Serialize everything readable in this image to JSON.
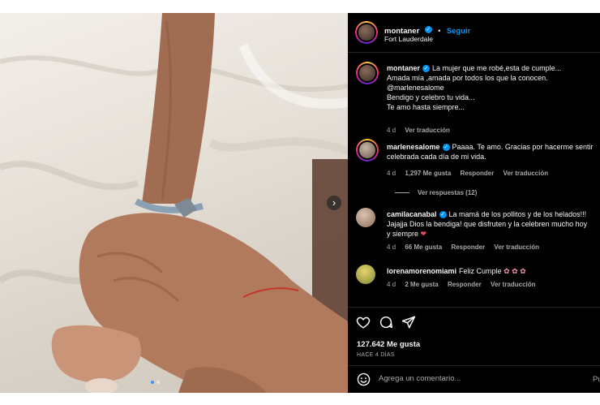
{
  "post": {
    "username": "montaner",
    "follow_label": "Seguir",
    "location": "Fort Lauderdale"
  },
  "caption": {
    "username": "montaner",
    "line1": "La mujer que me robé,esta de cumple...",
    "line2": "Amada mía ,amada por todos los que la conocen.",
    "line3": "@marlenesalome",
    "line4": "Bendigo y celebro tu vida...",
    "line5": "Te amo hasta siempre...",
    "time": "4 d",
    "translate": "Ver traducción"
  },
  "comments": [
    {
      "username": "marlenesalome",
      "line1": "Paaaa. Te amo. Gracias por hacerme sentir",
      "line2": "celebrada cada día de mi vida.",
      "time": "4 d",
      "likes": "1,297 Me gusta",
      "reply": "Responder",
      "translate": "Ver traducción",
      "replies": "Ver respuestas (12)"
    },
    {
      "username": "camilacanabal",
      "line1": "La mamá de los pollitos y de los helados!!!",
      "line2": "Jajajja Dios la bendiga! que disfruten y la celebren mucho hoy",
      "line3": "y siempre",
      "time": "4 d",
      "likes": "66 Me gusta",
      "reply": "Responder",
      "translate": "Ver traducción"
    },
    {
      "username": "lorenamorenomiami",
      "line1": "Feliz Cumple",
      "time": "4 d",
      "likes": "2 Me gusta",
      "reply": "Responder",
      "translate": "Ver traducción"
    }
  ],
  "stats": {
    "likes": "127.642 Me gusta",
    "ago": "HACE 4 DÍAS"
  },
  "composer": {
    "placeholder": "Agrega un comentario...",
    "post_label": "Pu"
  },
  "icons": [
    "heart-icon",
    "comment-icon",
    "share-icon",
    "emoji-icon",
    "verified-icon",
    "chevron-right-icon",
    "flower-emoji"
  ],
  "colors": {
    "accent": "#0095f6",
    "background": "#000000",
    "muted": "#a8a8a8",
    "heart": "#ed4956"
  }
}
